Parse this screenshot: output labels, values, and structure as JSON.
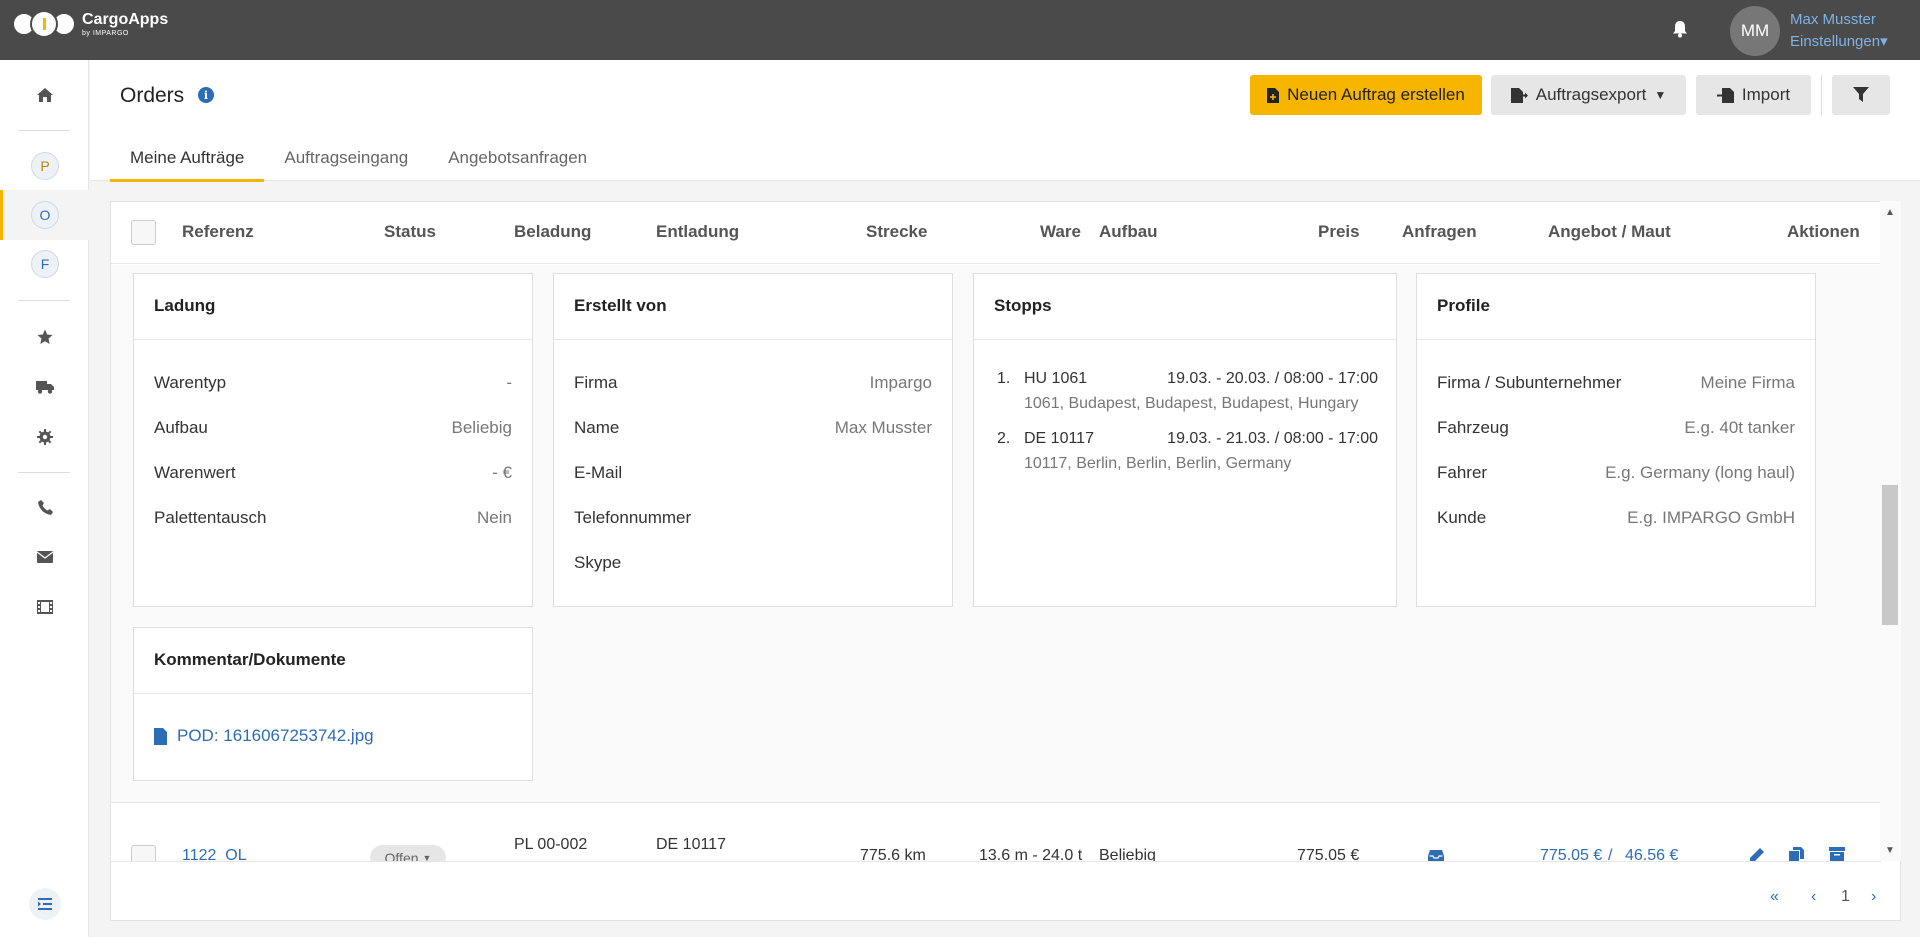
{
  "app": {
    "name": "CargoApps",
    "sub": "by IMPARGO"
  },
  "user": {
    "initials": "MM",
    "name": "Max Musster",
    "settings_label": "Einstellungen"
  },
  "sidebar": {
    "circles": [
      "P",
      "O",
      "F"
    ],
    "active": "O",
    "icons": [
      "home-icon",
      "star-icon",
      "truck-icon",
      "gear-icon",
      "phone-icon",
      "envelope-icon",
      "film-icon",
      "collapse-icon"
    ]
  },
  "page": {
    "title": "Orders",
    "tabs": [
      "Meine Aufträge",
      "Auftragseingang",
      "Angebotsanfragen"
    ],
    "active_tab": "Meine Aufträge"
  },
  "toolbar": {
    "new_order": "Neuen Auftrag erstellen",
    "export": "Auftragsexport",
    "import": "Import"
  },
  "table": {
    "headers": [
      "Referenz",
      "Status",
      "Beladung",
      "Entladung",
      "Strecke",
      "Ware",
      "Aufbau",
      "Preis",
      "Anfragen",
      "Angebot / Maut",
      "Aktionen"
    ]
  },
  "details": {
    "ladung": {
      "title": "Ladung",
      "rows": [
        {
          "label": "Warentyp",
          "value": "-"
        },
        {
          "label": "Aufbau",
          "value": "Beliebig"
        },
        {
          "label": "Warenwert",
          "value": "- €"
        },
        {
          "label": "Palettentausch",
          "value": "Nein"
        }
      ]
    },
    "erstellt": {
      "title": "Erstellt von",
      "rows": [
        {
          "label": "Firma",
          "value": "Impargo"
        },
        {
          "label": "Name",
          "value": "Max Musster"
        },
        {
          "label": "E-Mail",
          "value": ""
        },
        {
          "label": "Telefonnummer",
          "value": ""
        },
        {
          "label": "Skype",
          "value": ""
        }
      ]
    },
    "stopps": {
      "title": "Stopps",
      "items": [
        {
          "num": "1.",
          "code": "HU 1061",
          "time": "19.03. - 20.03. / 08:00 - 17:00",
          "address": "1061, Budapest, Budapest, Budapest, Hungary"
        },
        {
          "num": "2.",
          "code": "DE 10117",
          "time": "19.03. - 21.03. / 08:00 - 17:00",
          "address": "10117, Berlin, Berlin, Berlin, Germany"
        }
      ]
    },
    "profile": {
      "title": "Profile",
      "rows": [
        {
          "label": "Firma / Subunternehmer",
          "value": "Meine Firma"
        },
        {
          "label": "Fahrzeug",
          "value": "E.g. 40t tanker"
        },
        {
          "label": "Fahrer",
          "value": "E.g. Germany (long haul)"
        },
        {
          "label": "Kunde",
          "value": "E.g. IMPARGO GmbH"
        }
      ]
    },
    "kommentar": {
      "title": "Kommentar/Dokumente",
      "document": "POD: 1616067253742.jpg"
    }
  },
  "row": {
    "referenz": "1122_OL",
    "status": "Offen",
    "beladung": "PL 00-002",
    "entladung": "DE 10117",
    "strecke": "775.6 km",
    "ware": "13.6 m - 24.0 t",
    "aufbau": "Beliebig",
    "preis": "775.05 €",
    "angebot": "775.05 €",
    "angebot_sep": "/",
    "maut": "46.56 €"
  },
  "pagination": {
    "page": "1"
  },
  "colors": {
    "accent": "#f7b500",
    "link": "#2d6db5",
    "topbar": "#4a4a4a"
  }
}
